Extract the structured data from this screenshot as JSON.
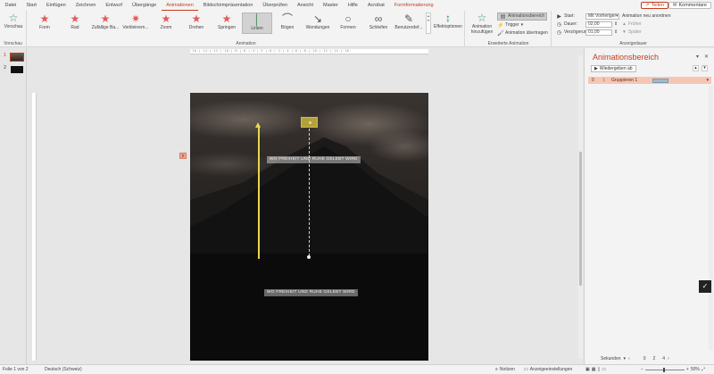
{
  "tabs": [
    "Datei",
    "Start",
    "Einfügen",
    "Zeichnen",
    "Entwurf",
    "Übergänge",
    "Animationen",
    "Bildschirmpräsentation",
    "Überprüfen",
    "Ansicht",
    "Master",
    "Hilfe",
    "Acrobat",
    "Formformatierung"
  ],
  "active_tab": "Animationen",
  "share_label": "Teilen",
  "comments_label": "Kommentare",
  "preview": {
    "label": "Vorschau",
    "group_label": "Vorschau"
  },
  "animation_gallery": {
    "items": [
      "Form",
      "Rad",
      "Zufällige Ba...",
      "Verkleinern...",
      "Zoom",
      "Drehen",
      "Springen",
      "Linien",
      "Bögen",
      "Wendungen",
      "Formen",
      "Schleifen",
      "Benutzerdef..."
    ],
    "selected": "Linien",
    "effect_options": "Effektoptionen",
    "group_label": "Animation"
  },
  "advanced": {
    "add_animation": "Animation hinzufügen",
    "animation_pane": "Animationsbereich",
    "trigger": "Trigger",
    "painter": "Animation übertragen",
    "group_label": "Erweiterte Animation"
  },
  "timing": {
    "start_label": "Start:",
    "start_value": "Mit Vorheriger",
    "duration_label": "Dauer:",
    "duration_value": "02,00",
    "delay_label": "Verzögerung:",
    "delay_value": "01,00",
    "reorder_label": "Animation neu anordnen",
    "earlier": "Früher",
    "later": "Später",
    "group_label": "Anzeigedauer"
  },
  "slides": [
    {
      "number": "1"
    },
    {
      "number": "2"
    }
  ],
  "slide": {
    "text_upper": "WO FREIHEIT UND RUHE GELEBT WIRD",
    "text_lower": "WO FREIHEIT UND RUHE GELEBT WIRD",
    "badge": "0"
  },
  "pane": {
    "title": "Animationsbereich",
    "play_label": "Wiedergeben ab",
    "row_number": "0",
    "row_label": "Gruppieren 1",
    "seconds_label": "Sekunden",
    "timeline": [
      "0",
      "2",
      "4"
    ]
  },
  "status": {
    "slide_info": "Folie 1 von 2",
    "language": "Deutsch (Schweiz)",
    "notes": "Notizen",
    "display_settings": "Anzeigeeinstellungen",
    "zoom": "50%"
  },
  "colors": {
    "accent": "#c43e1c",
    "motion_path": "#e9d84a",
    "pane_row": "#f6c6b5"
  }
}
